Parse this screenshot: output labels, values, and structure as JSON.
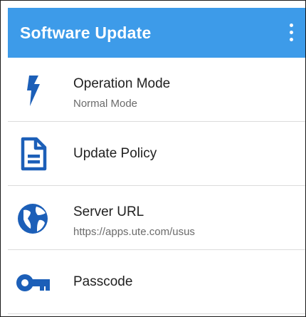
{
  "app_bar": {
    "title": "Software Update",
    "menu_icon": "more-vert-icon"
  },
  "colors": {
    "app_bar": "#3d9be9",
    "icon": "#1c5fb8",
    "title_text": "#212121",
    "subtitle_text": "#6b6b6b"
  },
  "settings": [
    {
      "icon": "flash-icon",
      "title": "Operation Mode",
      "subtitle": "Normal Mode"
    },
    {
      "icon": "document-icon",
      "title": "Update Policy"
    },
    {
      "icon": "globe-icon",
      "title": "Server URL",
      "subtitle": "https://apps.ute.com/usus"
    },
    {
      "icon": "key-icon",
      "title": "Passcode"
    }
  ]
}
